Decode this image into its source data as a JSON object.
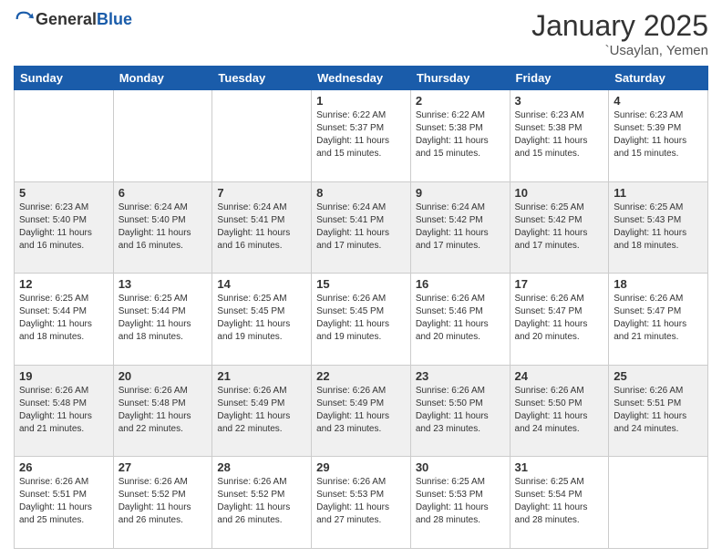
{
  "header": {
    "logo_general": "General",
    "logo_blue": "Blue",
    "month": "January 2025",
    "location": "`Usaylan, Yemen"
  },
  "weekdays": [
    "Sunday",
    "Monday",
    "Tuesday",
    "Wednesday",
    "Thursday",
    "Friday",
    "Saturday"
  ],
  "weeks": [
    [
      {
        "day": "",
        "info": ""
      },
      {
        "day": "",
        "info": ""
      },
      {
        "day": "",
        "info": ""
      },
      {
        "day": "1",
        "info": "Sunrise: 6:22 AM\nSunset: 5:37 PM\nDaylight: 11 hours and 15 minutes."
      },
      {
        "day": "2",
        "info": "Sunrise: 6:22 AM\nSunset: 5:38 PM\nDaylight: 11 hours and 15 minutes."
      },
      {
        "day": "3",
        "info": "Sunrise: 6:23 AM\nSunset: 5:38 PM\nDaylight: 11 hours and 15 minutes."
      },
      {
        "day": "4",
        "info": "Sunrise: 6:23 AM\nSunset: 5:39 PM\nDaylight: 11 hours and 15 minutes."
      }
    ],
    [
      {
        "day": "5",
        "info": "Sunrise: 6:23 AM\nSunset: 5:40 PM\nDaylight: 11 hours and 16 minutes."
      },
      {
        "day": "6",
        "info": "Sunrise: 6:24 AM\nSunset: 5:40 PM\nDaylight: 11 hours and 16 minutes."
      },
      {
        "day": "7",
        "info": "Sunrise: 6:24 AM\nSunset: 5:41 PM\nDaylight: 11 hours and 16 minutes."
      },
      {
        "day": "8",
        "info": "Sunrise: 6:24 AM\nSunset: 5:41 PM\nDaylight: 11 hours and 17 minutes."
      },
      {
        "day": "9",
        "info": "Sunrise: 6:24 AM\nSunset: 5:42 PM\nDaylight: 11 hours and 17 minutes."
      },
      {
        "day": "10",
        "info": "Sunrise: 6:25 AM\nSunset: 5:42 PM\nDaylight: 11 hours and 17 minutes."
      },
      {
        "day": "11",
        "info": "Sunrise: 6:25 AM\nSunset: 5:43 PM\nDaylight: 11 hours and 18 minutes."
      }
    ],
    [
      {
        "day": "12",
        "info": "Sunrise: 6:25 AM\nSunset: 5:44 PM\nDaylight: 11 hours and 18 minutes."
      },
      {
        "day": "13",
        "info": "Sunrise: 6:25 AM\nSunset: 5:44 PM\nDaylight: 11 hours and 18 minutes."
      },
      {
        "day": "14",
        "info": "Sunrise: 6:25 AM\nSunset: 5:45 PM\nDaylight: 11 hours and 19 minutes."
      },
      {
        "day": "15",
        "info": "Sunrise: 6:26 AM\nSunset: 5:45 PM\nDaylight: 11 hours and 19 minutes."
      },
      {
        "day": "16",
        "info": "Sunrise: 6:26 AM\nSunset: 5:46 PM\nDaylight: 11 hours and 20 minutes."
      },
      {
        "day": "17",
        "info": "Sunrise: 6:26 AM\nSunset: 5:47 PM\nDaylight: 11 hours and 20 minutes."
      },
      {
        "day": "18",
        "info": "Sunrise: 6:26 AM\nSunset: 5:47 PM\nDaylight: 11 hours and 21 minutes."
      }
    ],
    [
      {
        "day": "19",
        "info": "Sunrise: 6:26 AM\nSunset: 5:48 PM\nDaylight: 11 hours and 21 minutes."
      },
      {
        "day": "20",
        "info": "Sunrise: 6:26 AM\nSunset: 5:48 PM\nDaylight: 11 hours and 22 minutes."
      },
      {
        "day": "21",
        "info": "Sunrise: 6:26 AM\nSunset: 5:49 PM\nDaylight: 11 hours and 22 minutes."
      },
      {
        "day": "22",
        "info": "Sunrise: 6:26 AM\nSunset: 5:49 PM\nDaylight: 11 hours and 23 minutes."
      },
      {
        "day": "23",
        "info": "Sunrise: 6:26 AM\nSunset: 5:50 PM\nDaylight: 11 hours and 23 minutes."
      },
      {
        "day": "24",
        "info": "Sunrise: 6:26 AM\nSunset: 5:50 PM\nDaylight: 11 hours and 24 minutes."
      },
      {
        "day": "25",
        "info": "Sunrise: 6:26 AM\nSunset: 5:51 PM\nDaylight: 11 hours and 24 minutes."
      }
    ],
    [
      {
        "day": "26",
        "info": "Sunrise: 6:26 AM\nSunset: 5:51 PM\nDaylight: 11 hours and 25 minutes."
      },
      {
        "day": "27",
        "info": "Sunrise: 6:26 AM\nSunset: 5:52 PM\nDaylight: 11 hours and 26 minutes."
      },
      {
        "day": "28",
        "info": "Sunrise: 6:26 AM\nSunset: 5:52 PM\nDaylight: 11 hours and 26 minutes."
      },
      {
        "day": "29",
        "info": "Sunrise: 6:26 AM\nSunset: 5:53 PM\nDaylight: 11 hours and 27 minutes."
      },
      {
        "day": "30",
        "info": "Sunrise: 6:25 AM\nSunset: 5:53 PM\nDaylight: 11 hours and 28 minutes."
      },
      {
        "day": "31",
        "info": "Sunrise: 6:25 AM\nSunset: 5:54 PM\nDaylight: 11 hours and 28 minutes."
      },
      {
        "day": "",
        "info": ""
      }
    ]
  ]
}
